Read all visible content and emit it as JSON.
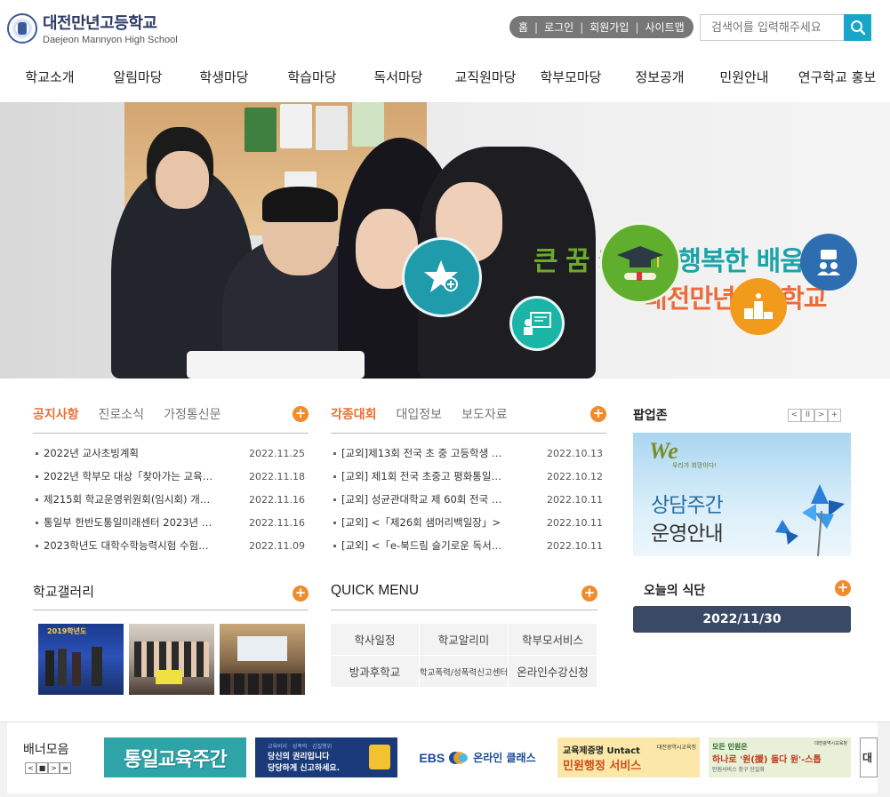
{
  "header": {
    "school_name_ko": "대전만년고등학교",
    "school_name_en": "Daejeon Mannyon High School",
    "util_links": [
      "홈",
      "로그인",
      "회원가입",
      "사이트맵"
    ],
    "search_placeholder": "검색어를 입력해주세요"
  },
  "gnb": [
    "학교소개",
    "알림마당",
    "학생마당",
    "학습마당",
    "독서마당",
    "교직원마당",
    "학부모마당",
    "정보공개",
    "민원안내",
    "연구학교 홍보"
  ],
  "hero": {
    "slogan_part1": "큰 꿈 키우는 ",
    "slogan_part2": "행복한 ",
    "slogan_part3": "배움터",
    "slogan_line2": "대전만년고등학교",
    "colors": {
      "green": "#6cab2a",
      "teal": "#1ba3a8",
      "orange": "#ec6b3a"
    }
  },
  "notice": {
    "tabs": [
      "공지사항",
      "진로소식",
      "가정통신문"
    ],
    "items": [
      {
        "title": "2022년 교사초빙계획",
        "date": "2022.11.25"
      },
      {
        "title": "2022년 학부모 대상「찾아가는 교육…",
        "date": "2022.11.18"
      },
      {
        "title": "제215회 학교운영위원회(임시회) 개…",
        "date": "2022.11.16"
      },
      {
        "title": "통일부 한반도통일미래센터 2023년 …",
        "date": "2022.11.16"
      },
      {
        "title": "2023학년도 대학수학능력시험 수험…",
        "date": "2022.11.09"
      }
    ]
  },
  "contest": {
    "tabs": [
      "각종대회",
      "대입정보",
      "보도자료"
    ],
    "items": [
      {
        "title": "[교외]제13회 전국 초 중 고등학생 …",
        "date": "2022.10.13"
      },
      {
        "title": "[교외] 제1회 전국 초중고 평화통일…",
        "date": "2022.10.12"
      },
      {
        "title": "[교외] 성균관대학교 제 60회 전국 …",
        "date": "2022.10.11"
      },
      {
        "title": "[교외] <「제26회 샘머리백일장」>",
        "date": "2022.10.11"
      },
      {
        "title": "[교외] <「e-북드림 슬기로운 독서…",
        "date": "2022.10.11"
      }
    ]
  },
  "gallery": {
    "title": "학교갤러리",
    "photo1_caption": "2019학년도"
  },
  "quick_menu": {
    "title": "QUICK MENU",
    "items": [
      "학사일정",
      "학교알리미",
      "학부모서비스",
      "방과후학교",
      "학교폭력/성폭력신고센터",
      "온라인수강신청"
    ]
  },
  "popup": {
    "title": "팝업존",
    "controls": [
      "<",
      "II",
      ">",
      "+"
    ],
    "image_logo": "We",
    "image_sub": "우리가 희망이다!",
    "image_text1": "상담주간",
    "image_text2": "운영안내"
  },
  "meal": {
    "title": "오늘의 식단",
    "date": "2022/11/30"
  },
  "banners": {
    "label": "배너모음",
    "controls": [
      "<",
      "■",
      ">",
      "≡"
    ],
    "items": [
      {
        "text": "통일교육주간"
      },
      {
        "line1": "교육비리 · 성폭력 · 갑질행위",
        "line2": "당신의 권리입니다",
        "line3": "당당하게 신고하세요."
      },
      {
        "text1": "EBS",
        "text2": "온라인 클래스"
      },
      {
        "line1": "교육제증명 Untact",
        "line2": "민원행정 서비스",
        "org": "대전광역시교육청"
      },
      {
        "line1": "모든 민원은",
        "line2": "하나로 '원(援) 돌다 원'-스톱",
        "line3": "민원서비스 창구 단일화",
        "org": "대전광역시교육청"
      },
      {
        "text": "대"
      }
    ]
  },
  "plus_icon": "+"
}
